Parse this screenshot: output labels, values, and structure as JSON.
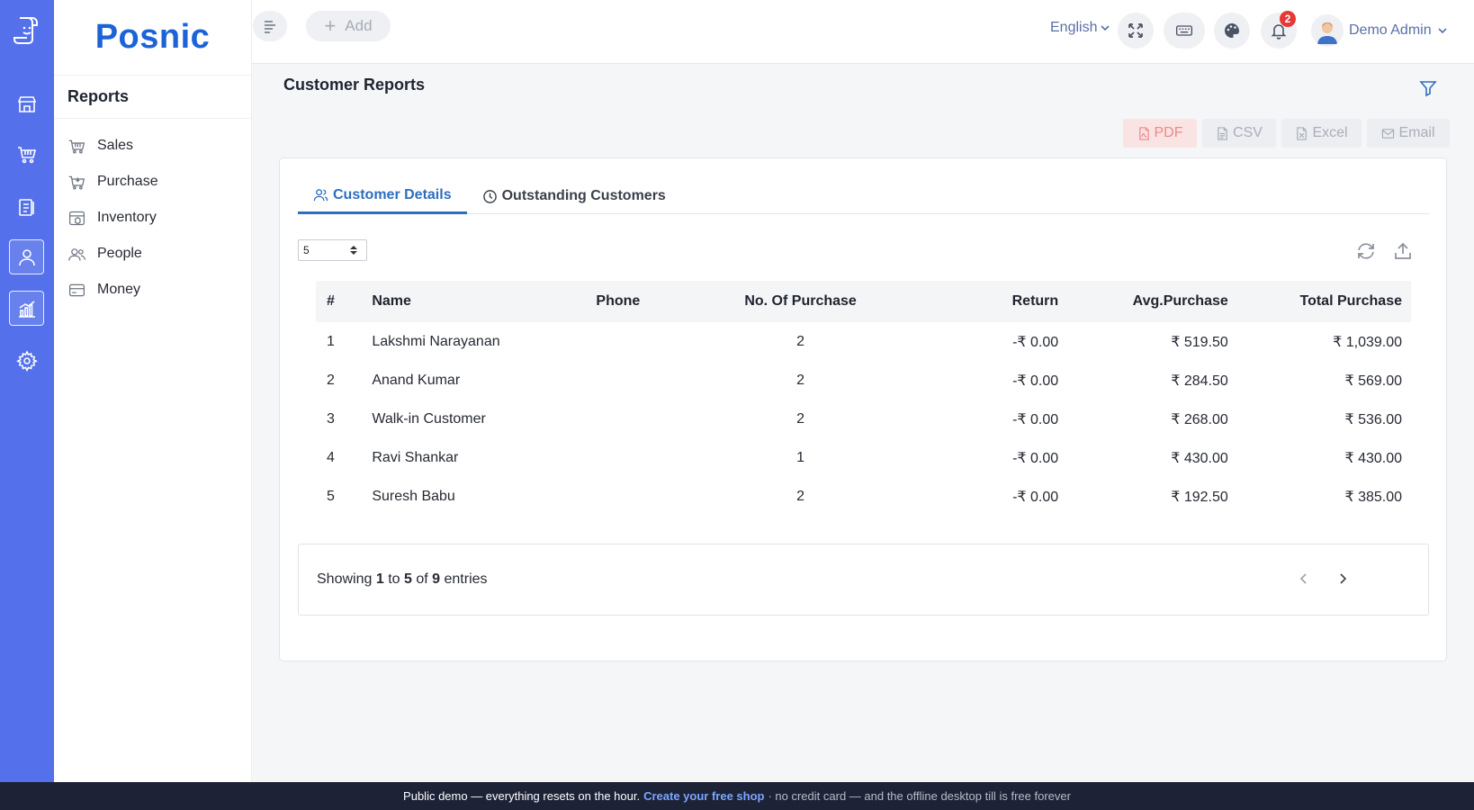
{
  "app": {
    "brand": "Posnic"
  },
  "rail": {
    "items": [
      {
        "name": "store-icon",
        "active": false
      },
      {
        "name": "cart-icon",
        "active": false
      },
      {
        "name": "clipboard-icon",
        "active": false
      },
      {
        "name": "user-icon",
        "active": true
      },
      {
        "name": "chart-icon",
        "active": true
      },
      {
        "name": "gear-icon",
        "active": false
      }
    ]
  },
  "sidebar": {
    "title": "Reports",
    "items": [
      {
        "label": "Sales",
        "icon": "basket-icon"
      },
      {
        "label": "Purchase",
        "icon": "cart-icon"
      },
      {
        "label": "Inventory",
        "icon": "box-icon"
      },
      {
        "label": "People",
        "icon": "people-icon"
      },
      {
        "label": "Money",
        "icon": "money-icon"
      }
    ]
  },
  "topbar": {
    "add_label": "Add",
    "language": "English",
    "notification_count": "2",
    "user_name": "Demo Admin"
  },
  "page": {
    "title": "Customer Reports",
    "export": {
      "pdf": "PDF",
      "csv": "CSV",
      "excel": "Excel",
      "email": "Email"
    },
    "tabs": [
      {
        "label": "Customer Details",
        "active": true
      },
      {
        "label": "Outstanding Customers",
        "active": false
      }
    ],
    "page_size": "5",
    "table": {
      "headers": [
        "#",
        "Name",
        "Phone",
        "No. Of Purchase",
        "Return",
        "Avg.Purchase",
        "Total Purchase"
      ],
      "rows": [
        [
          "1",
          "Lakshmi Narayanan",
          "",
          "2",
          "-₹ 0.00",
          "₹ 519.50",
          "₹ 1,039.00"
        ],
        [
          "2",
          "Anand Kumar",
          "",
          "2",
          "-₹ 0.00",
          "₹ 284.50",
          "₹ 569.00"
        ],
        [
          "3",
          "Walk-in Customer",
          "",
          "2",
          "-₹ 0.00",
          "₹ 268.00",
          "₹ 536.00"
        ],
        [
          "4",
          "Ravi Shankar",
          "",
          "1",
          "-₹ 0.00",
          "₹ 430.00",
          "₹ 430.00"
        ],
        [
          "5",
          "Suresh Babu",
          "",
          "2",
          "-₹ 0.00",
          "₹ 192.50",
          "₹ 385.00"
        ]
      ]
    },
    "pagination": {
      "showing": "Showing",
      "from": "1",
      "to_word": "to",
      "to": "5",
      "of_word": "of",
      "total": "9",
      "entries": "entries"
    }
  },
  "banner": {
    "text1": "Public demo — everything resets on the hour.",
    "link": "Create your free shop",
    "text2": "· no credit card — and the offline desktop till is free forever"
  },
  "colors": {
    "rail": "#5470ea",
    "brand": "#1c63d8",
    "accent": "#2d6ec0",
    "banner": "#1d2236"
  }
}
